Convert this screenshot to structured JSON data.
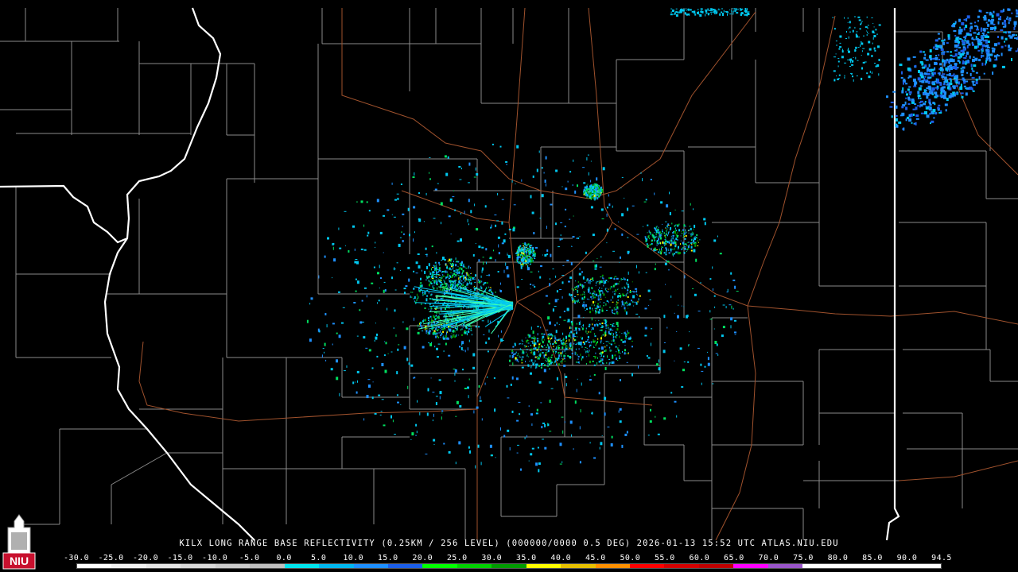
{
  "header": {
    "title": "KILX LONG RANGE BASE REFLECTIVITY (0.25KM / 256 LEVEL) (000000/0000 0.5 DEG) 2026-01-13 15:52 UTC  ATLAS.NIU.EDU"
  },
  "logo": {
    "text": "NIU",
    "icon": "university-tower-icon",
    "color": "#c8102e"
  },
  "colorbar": {
    "tick_labels": [
      "-30.0",
      "-25.0",
      "-20.0",
      "-15.0",
      "-10.0",
      "-5.0",
      "0.0",
      "5.0",
      "10.0",
      "15.0",
      "20.0",
      "25.0",
      "30.0",
      "35.0",
      "40.0",
      "45.0",
      "50.0",
      "55.0",
      "60.0",
      "65.0",
      "70.0",
      "75.0",
      "80.0",
      "85.0",
      "90.0",
      "94.5"
    ],
    "colors": [
      "#ffffff",
      "#f2f2f2",
      "#e6e6e6",
      "#d9d9d9",
      "#cccccc",
      "#bfbfbf",
      "#00e5ee",
      "#00b7f0",
      "#1e8fff",
      "#1c5ee8",
      "#00ff00",
      "#00d000",
      "#009a00",
      "#ffff00",
      "#e6c000",
      "#ff9000",
      "#ff0000",
      "#d40000",
      "#bf0000",
      "#ff00ff",
      "#9955c9",
      "#ffffff",
      "#ffffff",
      "#ffffff",
      "#ffffff"
    ]
  },
  "map": {
    "background": "#000000",
    "county_line_color": "#8a8a8a",
    "state_line_color": "#ffffff",
    "highway_color": "#a0522d",
    "echo_colors": [
      "#00c8f0",
      "#1e90ff",
      "#1c5ee8",
      "#00e060",
      "#00a000",
      "#ffff00",
      "#40ffb0"
    ]
  }
}
